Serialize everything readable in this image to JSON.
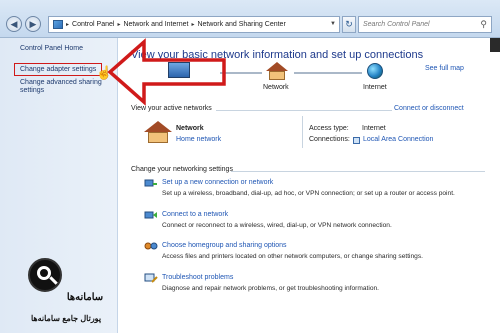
{
  "addressbar": {
    "crumbs": [
      "Control Panel",
      "Network and Internet",
      "Network and Sharing Center"
    ],
    "search_placeholder": "Search Control Panel"
  },
  "leftpane": {
    "home": "Control Panel Home",
    "change_adapter": "Change adapter settings",
    "change_sharing_line1": "Change advanced sharing",
    "change_sharing_line2": "settings"
  },
  "watermark": {
    "brand": "سامانه‌ها",
    "tagline": "پورتال جامع سامانه‌ها"
  },
  "main": {
    "title": "View your basic network information and set up connections",
    "see_full_map": "See full map",
    "map": {
      "network_label": "Network",
      "internet_label": "Internet"
    },
    "active_networks_heading": "View your active networks",
    "connect_or_disconnect": "Connect or disconnect",
    "network_name": "Network",
    "network_type": "Home network",
    "access_type_label": "Access type:",
    "access_type_value": "Internet",
    "connections_label": "Connections:",
    "connections_value": "Local Area Connection",
    "settings_heading": "Change your networking settings",
    "tasks": [
      {
        "title": "Set up a new connection or network",
        "desc": "Set up a wireless, broadband, dial-up, ad hoc, or VPN connection; or set up a router or access point."
      },
      {
        "title": "Connect to a network",
        "desc": "Connect or reconnect to a wireless, wired, dial-up, or VPN network connection."
      },
      {
        "title": "Choose homegroup and sharing options",
        "desc": "Access files and printers located on other network computers, or change sharing settings."
      },
      {
        "title": "Troubleshoot problems",
        "desc": "Diagnose and repair network problems, or get troubleshooting information."
      }
    ]
  },
  "colors": {
    "link": "#1f56b4",
    "title": "#1e3a8c",
    "annotation_red": "#d01a1a"
  }
}
